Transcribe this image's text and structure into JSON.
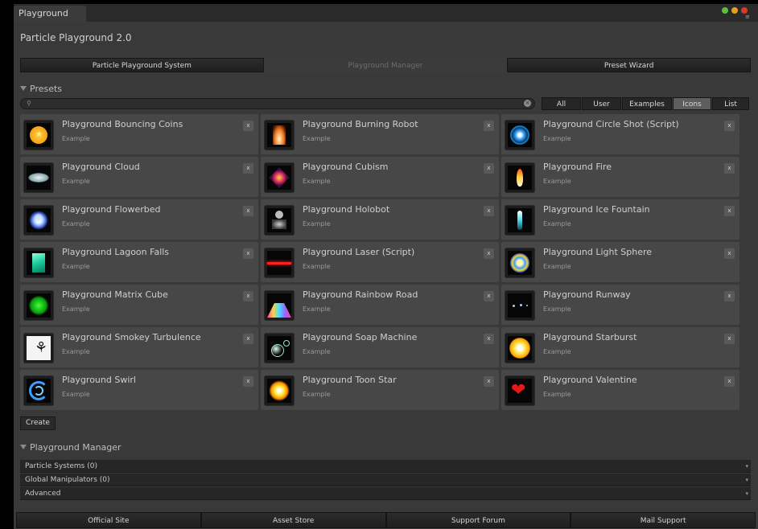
{
  "window": {
    "tab_label": "Playground",
    "app_title": "Particle Playground 2.0",
    "controls": [
      "green-dot",
      "yellow-dot",
      "red-dot"
    ]
  },
  "toolbar": {
    "system_label": "Particle Playground System",
    "manager_label": "Playground Manager",
    "wizard_label": "Preset Wizard"
  },
  "presets": {
    "header": "Presets",
    "search": {
      "value": "",
      "placeholder": ""
    },
    "filters": [
      {
        "label": "All",
        "selected": false
      },
      {
        "label": "User",
        "selected": false
      },
      {
        "label": "Examples",
        "selected": false
      },
      {
        "label": "Icons",
        "selected": true
      },
      {
        "label": "List",
        "selected": false
      }
    ],
    "delete_label": "x",
    "create_label": "Create",
    "items": [
      {
        "title": "Playground Bouncing Coins",
        "sub": "Example",
        "icon": "coin-icon"
      },
      {
        "title": "Playground Burning Robot",
        "sub": "Example",
        "icon": "burning-robot-icon"
      },
      {
        "title": "Playground Circle Shot (Script)",
        "sub": "Example",
        "icon": "circle-shot-icon"
      },
      {
        "title": "Playground Cloud",
        "sub": "Example",
        "icon": "cloud-icon"
      },
      {
        "title": "Playground Cubism",
        "sub": "Example",
        "icon": "cubism-icon"
      },
      {
        "title": "Playground Fire",
        "sub": "Example",
        "icon": "fire-icon"
      },
      {
        "title": "Playground Flowerbed",
        "sub": "Example",
        "icon": "flower-icon"
      },
      {
        "title": "Playground Holobot",
        "sub": "Example",
        "icon": "holobot-icon"
      },
      {
        "title": "Playground Ice Fountain",
        "sub": "Example",
        "icon": "ice-fountain-icon"
      },
      {
        "title": "Playground Lagoon Falls",
        "sub": "Example",
        "icon": "lagoon-falls-icon"
      },
      {
        "title": "Playground Laser (Script)",
        "sub": "Example",
        "icon": "laser-icon"
      },
      {
        "title": "Playground Light Sphere",
        "sub": "Example",
        "icon": "light-sphere-icon"
      },
      {
        "title": "Playground Matrix Cube",
        "sub": "Example",
        "icon": "matrix-cube-icon"
      },
      {
        "title": "Playground Rainbow Road",
        "sub": "Example",
        "icon": "rainbow-road-icon"
      },
      {
        "title": "Playground Runway",
        "sub": "Example",
        "icon": "runway-icon"
      },
      {
        "title": "Playground Smokey Turbulence",
        "sub": "Example",
        "icon": "smokey-turbulence-icon"
      },
      {
        "title": "Playground Soap Machine",
        "sub": "Example",
        "icon": "soap-bubble-icon"
      },
      {
        "title": "Playground Starburst",
        "sub": "Example",
        "icon": "starburst-icon"
      },
      {
        "title": "Playground Swirl",
        "sub": "Example",
        "icon": "swirl-icon"
      },
      {
        "title": "Playground Toon Star",
        "sub": "Example",
        "icon": "toon-star-icon"
      },
      {
        "title": "Playground Valentine",
        "sub": "Example",
        "icon": "heart-icon"
      }
    ]
  },
  "manager": {
    "header": "Playground Manager",
    "rows": [
      "Particle Systems (0)",
      "Global Manipulators (0)",
      "Advanced"
    ]
  },
  "footer": {
    "buttons": [
      "Official Site",
      "Asset Store",
      "Support Forum",
      "Mail Support"
    ]
  },
  "colors": {
    "panel": "#393939",
    "card": "#474747",
    "button_dark": "#262626",
    "text": "#c8c8c8"
  }
}
